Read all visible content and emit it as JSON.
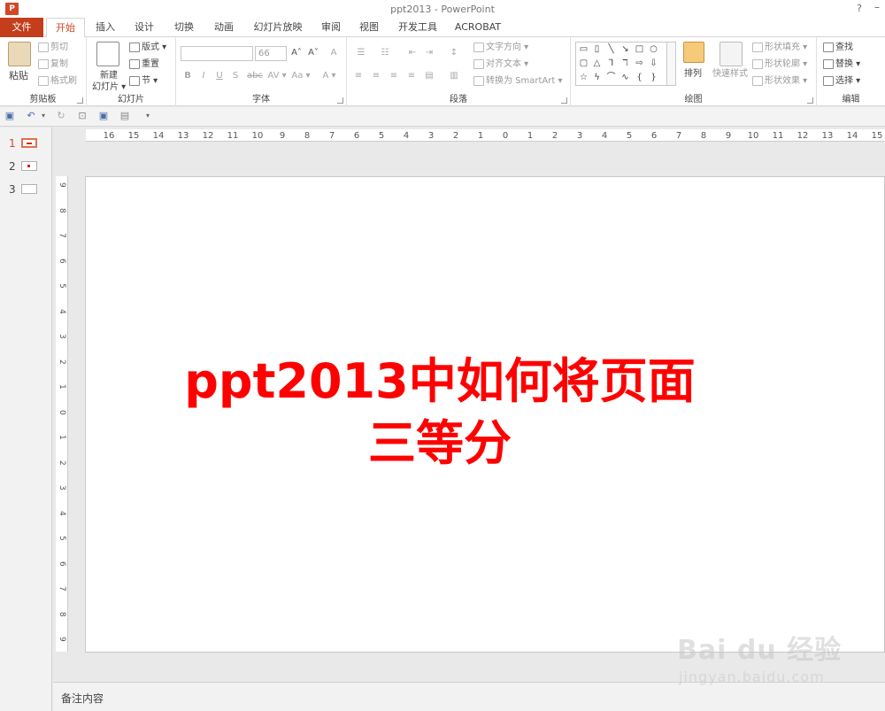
{
  "app": {
    "icon_label": "P",
    "title": "ppt2013 - PowerPoint",
    "help": "?",
    "minimize": "–"
  },
  "tabs": [
    {
      "label": "文件"
    },
    {
      "label": "开始"
    },
    {
      "label": "插入"
    },
    {
      "label": "设计"
    },
    {
      "label": "切换"
    },
    {
      "label": "动画"
    },
    {
      "label": "幻灯片放映"
    },
    {
      "label": "审阅"
    },
    {
      "label": "视图"
    },
    {
      "label": "开发工具"
    },
    {
      "label": "ACROBAT"
    }
  ],
  "ribbon": {
    "clipboard": {
      "label": "剪贴板",
      "paste": "粘贴",
      "cut": "剪切",
      "copy": "复制",
      "format_painter": "格式刷"
    },
    "slides": {
      "label": "幻灯片",
      "new_slide_1": "新建",
      "new_slide_2": "幻灯片 ▾",
      "layout": "版式 ▾",
      "reset": "重置",
      "section": "节 ▾"
    },
    "font": {
      "label": "字体",
      "font_name": "",
      "font_size": "66",
      "grow": "A˄",
      "shrink": "A˅",
      "clear": "A",
      "bold": "B",
      "italic": "I",
      "underline": "U",
      "shadow": "S",
      "strike": "abc",
      "spacing": "AV ▾",
      "case": "Aa ▾",
      "color": "A ▾"
    },
    "paragraph": {
      "label": "段落",
      "text_direction": "文字方向 ▾",
      "align_text": "对齐文本 ▾",
      "smartart": "转换为 SmartArt ▾"
    },
    "drawing": {
      "label": "绘图",
      "arrange": "排列",
      "quick_styles": "快速样式",
      "shape_fill": "形状填充 ▾",
      "shape_outline": "形状轮廓 ▾",
      "shape_effects": "形状效果 ▾"
    },
    "editing": {
      "label": "编辑",
      "find": "查找",
      "replace": "替换 ▾",
      "select": "选择 ▾"
    }
  },
  "qat": {
    "save": "💾",
    "undo": "↶",
    "undo_drop": "▾",
    "redo": "↻",
    "customize": "▾"
  },
  "thumbnails": [
    {
      "number": "1"
    },
    {
      "number": "2"
    },
    {
      "number": "3"
    }
  ],
  "ruler": {
    "horizontal": [
      "16",
      "15",
      "14",
      "13",
      "12",
      "11",
      "10",
      "9",
      "8",
      "7",
      "6",
      "5",
      "4",
      "3",
      "2",
      "1",
      "0",
      "1",
      "2",
      "3",
      "4",
      "5",
      "6",
      "7",
      "8",
      "9",
      "10",
      "11",
      "12",
      "13",
      "14",
      "15"
    ],
    "vertical": [
      "9",
      "8",
      "7",
      "6",
      "5",
      "4",
      "3",
      "2",
      "1",
      "0",
      "1",
      "2",
      "3",
      "4",
      "5",
      "6",
      "7",
      "8",
      "9"
    ]
  },
  "slide": {
    "title_line1": "ppt2013中如何将页面",
    "title_line2": "三等分",
    "title_color": "#ff0000"
  },
  "notes": {
    "placeholder": "备注内容"
  },
  "watermark": {
    "logo": "Bai du 经验",
    "url": "jingyan.baidu.com"
  },
  "colors": {
    "accent": "#d24726",
    "file_tab": "#c43e1c"
  }
}
